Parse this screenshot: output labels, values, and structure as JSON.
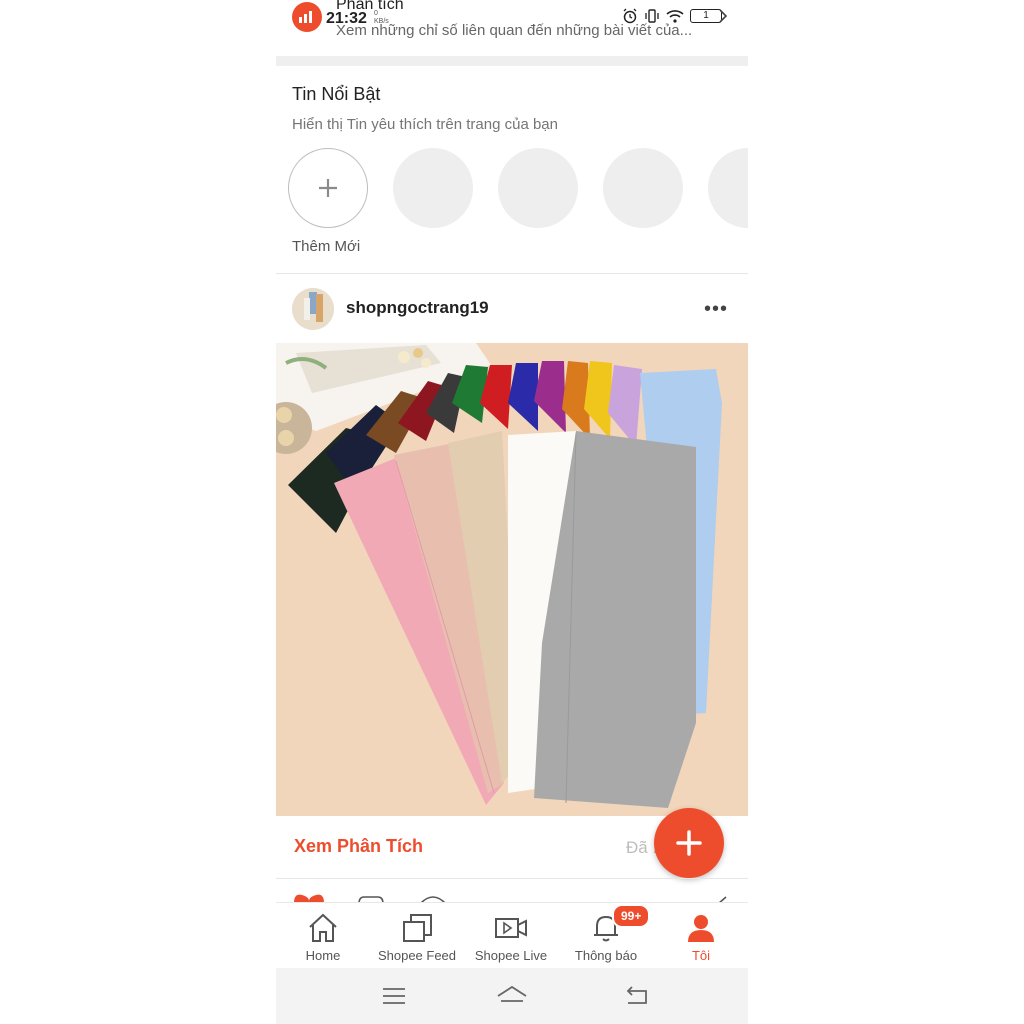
{
  "header": {
    "status_time": "21:32",
    "status_speed": "0\nKB/s",
    "analytics_title": "Phân tích",
    "analytics_subtitle": "Xem những chỉ số liên quan đến những bài viết của...",
    "battery": "1"
  },
  "highlights": {
    "title": "Tin Nổi Bật",
    "subtitle": "Hiển thị Tin yêu thích trên trang của bạn",
    "add_label": "Thêm Mới"
  },
  "post": {
    "username": "shopngoctrang19",
    "more": "•••",
    "view_analysis": "Xem Phân Tích",
    "status_text": "Đã ... á"
  },
  "nav": {
    "items": [
      {
        "label": "Home",
        "icon": "home-icon"
      },
      {
        "label": "Shopee Feed",
        "icon": "feed-icon"
      },
      {
        "label": "Shopee Live",
        "icon": "live-icon"
      },
      {
        "label": "Thông báo",
        "icon": "bell-icon"
      },
      {
        "label": "Tôi",
        "icon": "user-icon"
      }
    ],
    "badge": "99+"
  },
  "colors": {
    "accent": "#ee4d2d",
    "active_tab": "#ee4d2d"
  }
}
